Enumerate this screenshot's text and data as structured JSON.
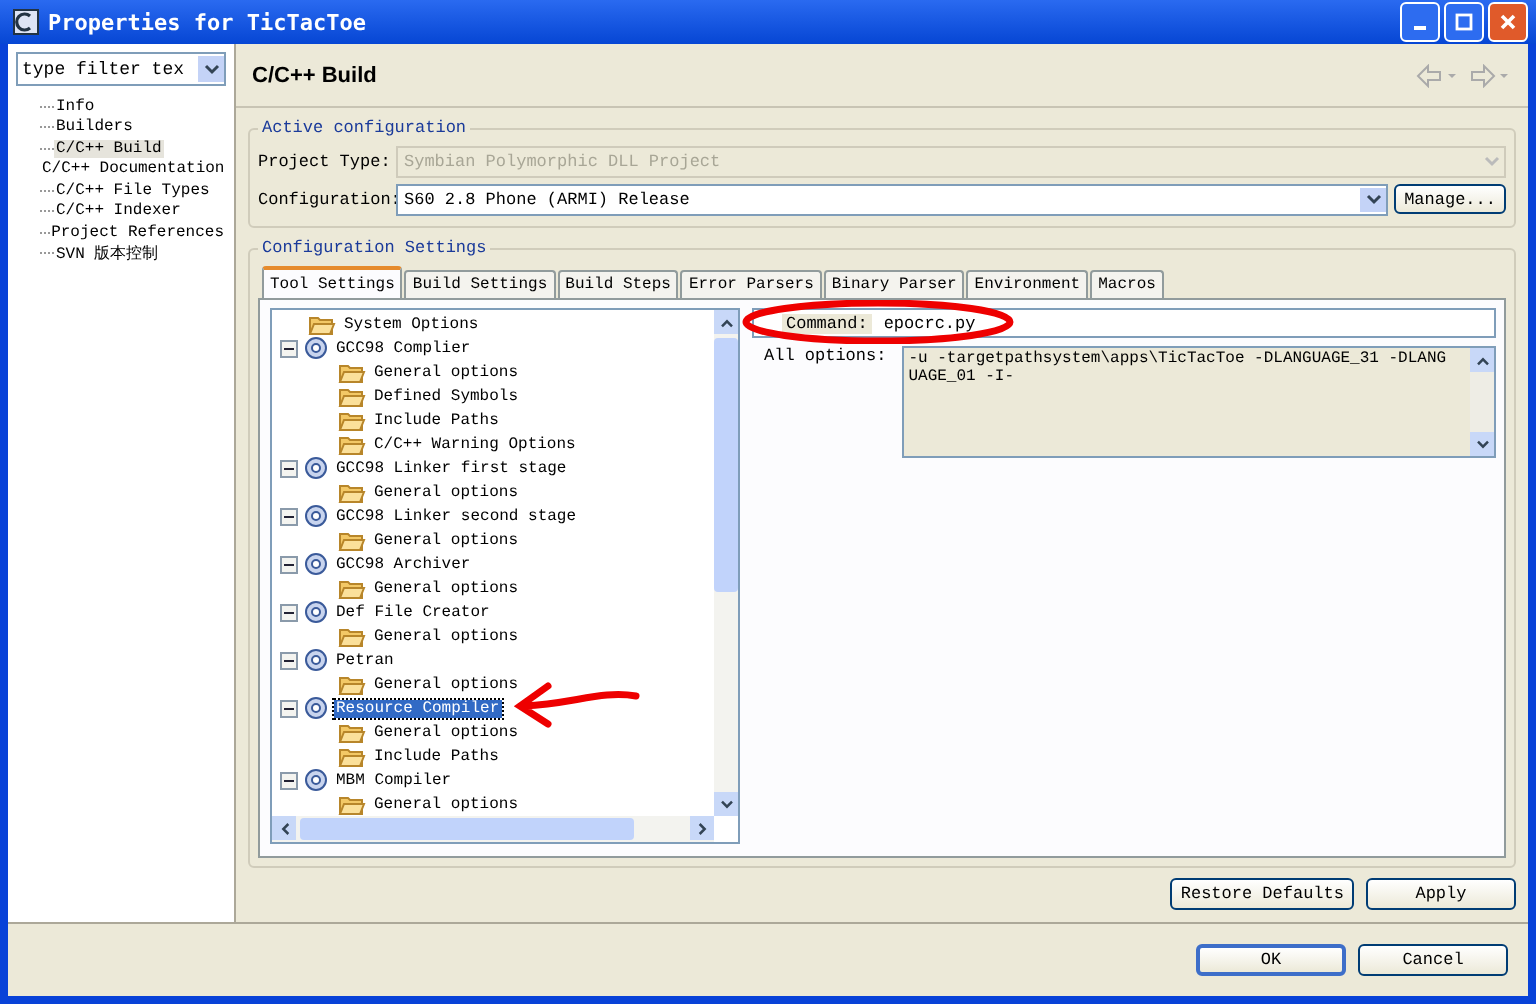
{
  "window": {
    "title": "Properties for TicTacToe"
  },
  "filter": {
    "value": "type filter tex"
  },
  "nav": [
    {
      "label": "Info",
      "selected": false
    },
    {
      "label": "Builders",
      "selected": false
    },
    {
      "label": "C/C++ Build",
      "selected": true
    },
    {
      "label": "C/C++ Documentation",
      "selected": false
    },
    {
      "label": "C/C++ File Types",
      "selected": false
    },
    {
      "label": "C/C++ Indexer",
      "selected": false
    },
    {
      "label": "Project References",
      "selected": false
    },
    {
      "label": "SVN 版本控制",
      "selected": false
    }
  ],
  "page_title": "C/C++ Build",
  "active_configuration": {
    "title": "Active configuration",
    "project_type_label": "Project Type:",
    "project_type": "Symbian Polymorphic DLL Project",
    "project_type_disabled": true,
    "configuration_label": "Configuration:",
    "configuration": "S60 2.8 Phone (ARMI) Release",
    "manage_button": "Manage..."
  },
  "configuration_settings": {
    "title": "Configuration Settings",
    "tabs": [
      {
        "label": "Tool Settings",
        "selected": true
      },
      {
        "label": "Build Settings",
        "selected": false
      },
      {
        "label": "Build Steps",
        "selected": false
      },
      {
        "label": "Error Parsers",
        "selected": false
      },
      {
        "label": "Binary Parser",
        "selected": false
      },
      {
        "label": "Environment",
        "selected": false
      },
      {
        "label": "Macros",
        "selected": false
      }
    ],
    "tree": [
      {
        "label": "System Options",
        "kind": "options",
        "selected": false
      },
      {
        "label": "GCC98 Complier",
        "kind": "tool",
        "expanded": true,
        "selected": false,
        "children": [
          {
            "label": "General options",
            "kind": "options",
            "selected": false
          },
          {
            "label": "Defined Symbols",
            "kind": "options",
            "selected": false
          },
          {
            "label": "Include Paths",
            "kind": "options",
            "selected": false
          },
          {
            "label": "C/C++ Warning Options",
            "kind": "options",
            "selected": false
          }
        ]
      },
      {
        "label": "GCC98 Linker first stage",
        "kind": "tool",
        "expanded": true,
        "selected": false,
        "children": [
          {
            "label": "General options",
            "kind": "options",
            "selected": false
          }
        ]
      },
      {
        "label": "GCC98 Linker second stage",
        "kind": "tool",
        "expanded": true,
        "selected": false,
        "children": [
          {
            "label": "General options",
            "kind": "options",
            "selected": false
          }
        ]
      },
      {
        "label": "GCC98 Archiver",
        "kind": "tool",
        "expanded": true,
        "selected": false,
        "children": [
          {
            "label": "General options",
            "kind": "options",
            "selected": false
          }
        ]
      },
      {
        "label": "Def File Creator",
        "kind": "tool",
        "expanded": true,
        "selected": false,
        "children": [
          {
            "label": "General options",
            "kind": "options",
            "selected": false
          }
        ]
      },
      {
        "label": "Petran",
        "kind": "tool",
        "expanded": true,
        "selected": false,
        "children": [
          {
            "label": "General options",
            "kind": "options",
            "selected": false
          }
        ]
      },
      {
        "label": "Resource Compiler",
        "kind": "tool",
        "expanded": true,
        "selected": true,
        "children": [
          {
            "label": "General options",
            "kind": "options",
            "selected": false
          },
          {
            "label": "Include Paths",
            "kind": "options",
            "selected": false
          }
        ]
      },
      {
        "label": "MBM Compiler",
        "kind": "tool",
        "expanded": true,
        "selected": false,
        "children": [
          {
            "label": "General options",
            "kind": "options",
            "selected": false
          }
        ]
      }
    ],
    "command_label": "Command:",
    "command": "epocrc.py",
    "all_options_label": "All options:",
    "all_options": "-u -targetpathsystem\\apps\\TicTacToe -DLANGUAGE_31 -DLANGUAGE_01 -I-"
  },
  "buttons": {
    "restore": "Restore Defaults",
    "apply": "Apply",
    "ok": "OK",
    "cancel": "Cancel"
  }
}
